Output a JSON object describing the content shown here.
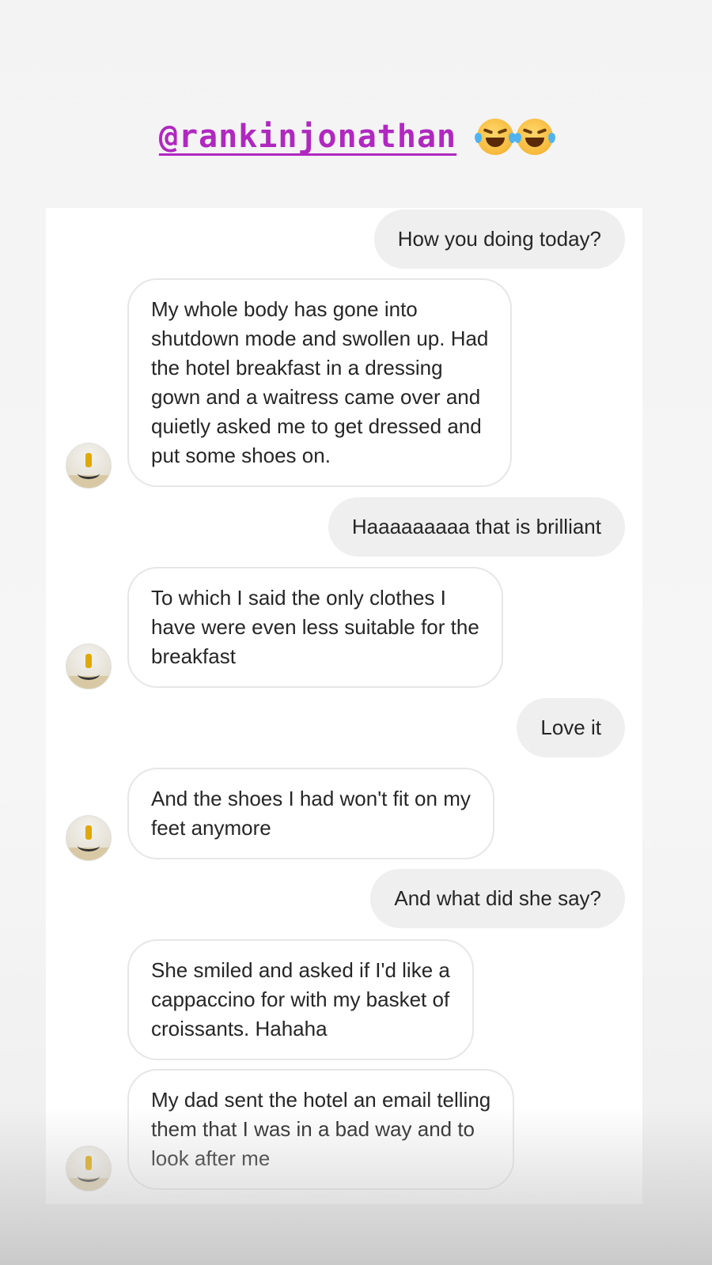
{
  "mention": {
    "handle": "@rankinjonathan",
    "emoji_icons": [
      "face-with-tears-of-joy-icon",
      "face-with-tears-of-joy-icon"
    ]
  },
  "colors": {
    "mention": "#b028c0",
    "sent_bubble": "#efefef",
    "received_border": "#e6e6e6",
    "text": "#262626"
  },
  "messages": [
    {
      "direction": "sent",
      "text": "How you doing today?"
    },
    {
      "direction": "received",
      "text": "My whole body has gone into\nshutdown mode and swollen up. Had\nthe hotel breakfast in a dressing\ngown and a waitress came over and\nquietly asked me to get dressed and\nput some shoes on."
    },
    {
      "direction": "sent",
      "text": "Haaaaaaaaa that is brilliant"
    },
    {
      "direction": "received",
      "text": "To which I said the only clothes I\nhave were even less suitable for the\nbreakfast"
    },
    {
      "direction": "sent",
      "text": "Love it"
    },
    {
      "direction": "received",
      "text": "And the shoes I had won't fit on my\nfeet anymore"
    },
    {
      "direction": "sent",
      "text": "And what did she say?"
    },
    {
      "direction": "received",
      "text": "She smiled and asked if I'd like a\ncappaccino for with my basket of\ncroissants. Hahaha"
    },
    {
      "direction": "received",
      "text": "My dad sent the hotel an email telling\nthem that I was in a bad way and to\nlook after me"
    }
  ]
}
